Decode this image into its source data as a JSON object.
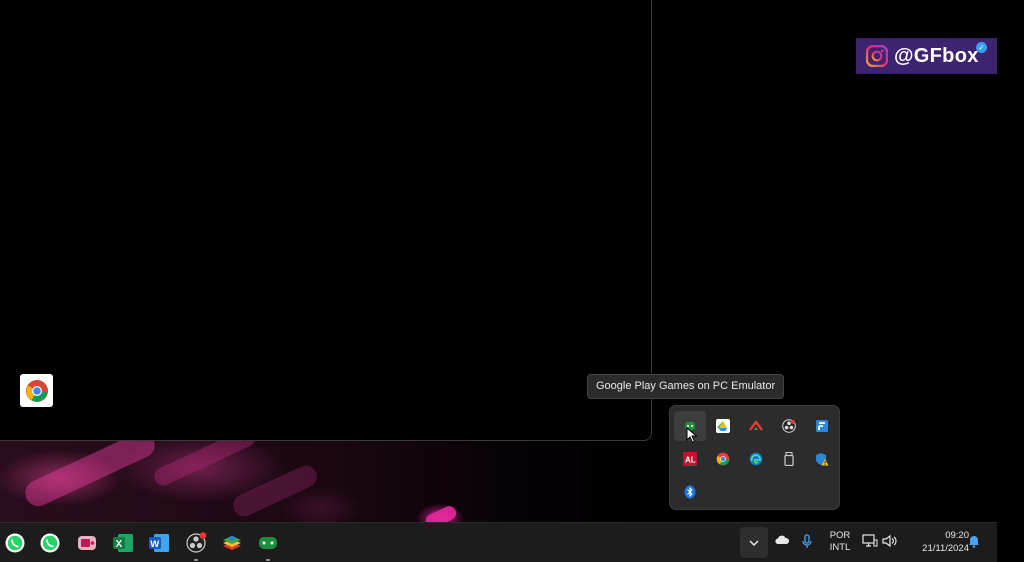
{
  "watermark": {
    "handle": "@GFbox",
    "icon": "instagram-icon",
    "verified": true
  },
  "tooltip": {
    "text": "Google Play Games on PC Emulator"
  },
  "desktop": {
    "shortcuts": [
      {
        "icon": "chrome-icon"
      }
    ]
  },
  "tray_overflow": {
    "icons": [
      {
        "name": "google-play-games-icon",
        "hovered": true
      },
      {
        "name": "google-drive-icon"
      },
      {
        "name": "red-arrow-app-icon"
      },
      {
        "name": "obs-icon"
      },
      {
        "name": "blue-app-icon"
      },
      {
        "name": "amd-icon"
      },
      {
        "name": "chrome-icon"
      },
      {
        "name": "edge-icon"
      },
      {
        "name": "usb-drive-icon"
      },
      {
        "name": "security-warning-icon"
      },
      {
        "name": "bluetooth-icon"
      }
    ]
  },
  "taskbar": {
    "pinned_apps": [
      {
        "name": "whatsapp-icon"
      },
      {
        "name": "whatsapp-icon"
      },
      {
        "name": "screen-recorder-icon"
      },
      {
        "name": "excel-icon",
        "letter": "X"
      },
      {
        "name": "word-icon",
        "letter": "W"
      },
      {
        "name": "obs-icon",
        "badge": true
      },
      {
        "name": "bluestacks-icon"
      },
      {
        "name": "google-play-games-icon",
        "running": true
      }
    ],
    "system_tray": {
      "language_line1": "POR",
      "language_line2": "INTL",
      "time": "09:20",
      "date": "21/11/2024"
    }
  },
  "colors": {
    "taskbar_bg": "#1c1c1c",
    "flyout_bg": "#2c2c2c",
    "watermark_bg": "#3d2470",
    "accent_pink": "#d21d8e"
  }
}
